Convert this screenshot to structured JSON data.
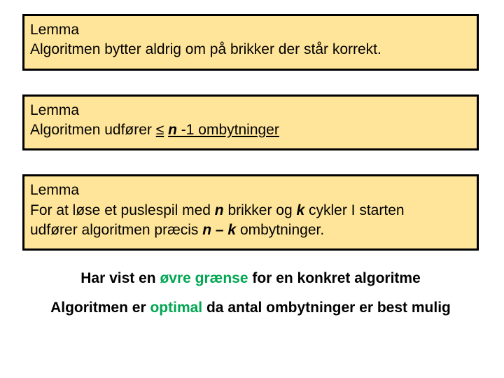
{
  "lemma1": {
    "title": "Lemma",
    "body": "Algoritmen bytter aldrig om på brikker der står korrekt."
  },
  "lemma2": {
    "title": "Lemma",
    "prefix": "Algoritmen udfører ",
    "leq": "≤",
    "n": "n",
    "suffix1": " -1",
    "suffix2": " ombytninger"
  },
  "lemma3": {
    "title": "Lemma",
    "p1a": "For at løse et puslespil med ",
    "n": "n",
    "p1b": " brikker og ",
    "k": "k",
    "p1c": " cykler I starten",
    "p2a": "udfører algoritmen præcis ",
    "nk": "n – k",
    "p2b": " ombytninger."
  },
  "conc1": {
    "a": "Har vist en ",
    "b": "øvre grænse",
    "c": " for en konkret algoritme"
  },
  "conc2": {
    "a": "Algoritmen er ",
    "b": "optimal",
    "c": " da antal ombytninger er best mulig"
  }
}
